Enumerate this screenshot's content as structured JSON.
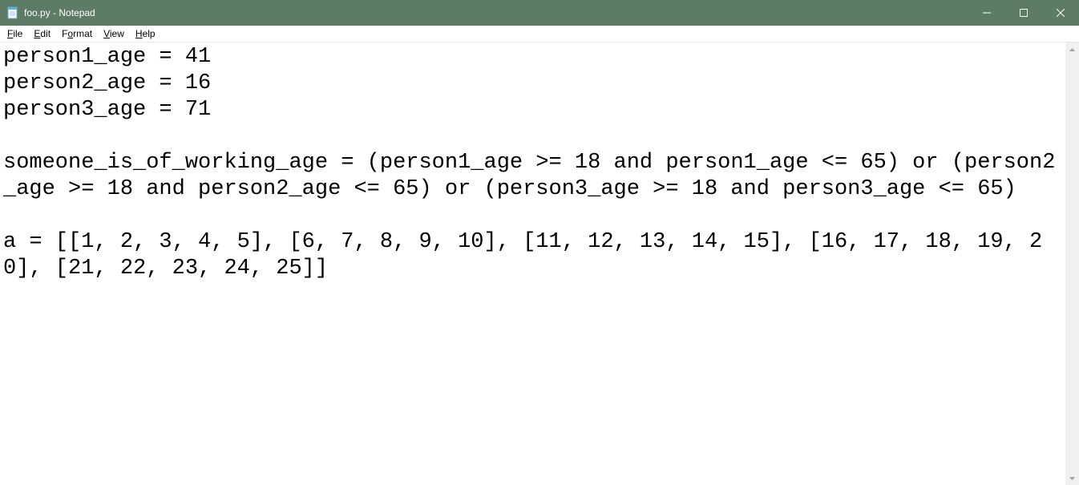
{
  "window": {
    "title": "foo.py - Notepad"
  },
  "menu": {
    "file": "File",
    "edit": "Edit",
    "format": "Format",
    "view": "View",
    "help": "Help"
  },
  "editor": {
    "content": "person1_age = 41\nperson2_age = 16\nperson3_age = 71\n\nsomeone_is_of_working_age = (person1_age >= 18 and person1_age <= 65) or (person2_age >= 18 and person2_age <= 65) or (person3_age >= 18 and person3_age <= 65)\n\na = [[1, 2, 3, 4, 5], [6, 7, 8, 9, 10], [11, 12, 13, 14, 15], [16, 17, 18, 19, 20], [21, 22, 23, 24, 25]]\n"
  }
}
